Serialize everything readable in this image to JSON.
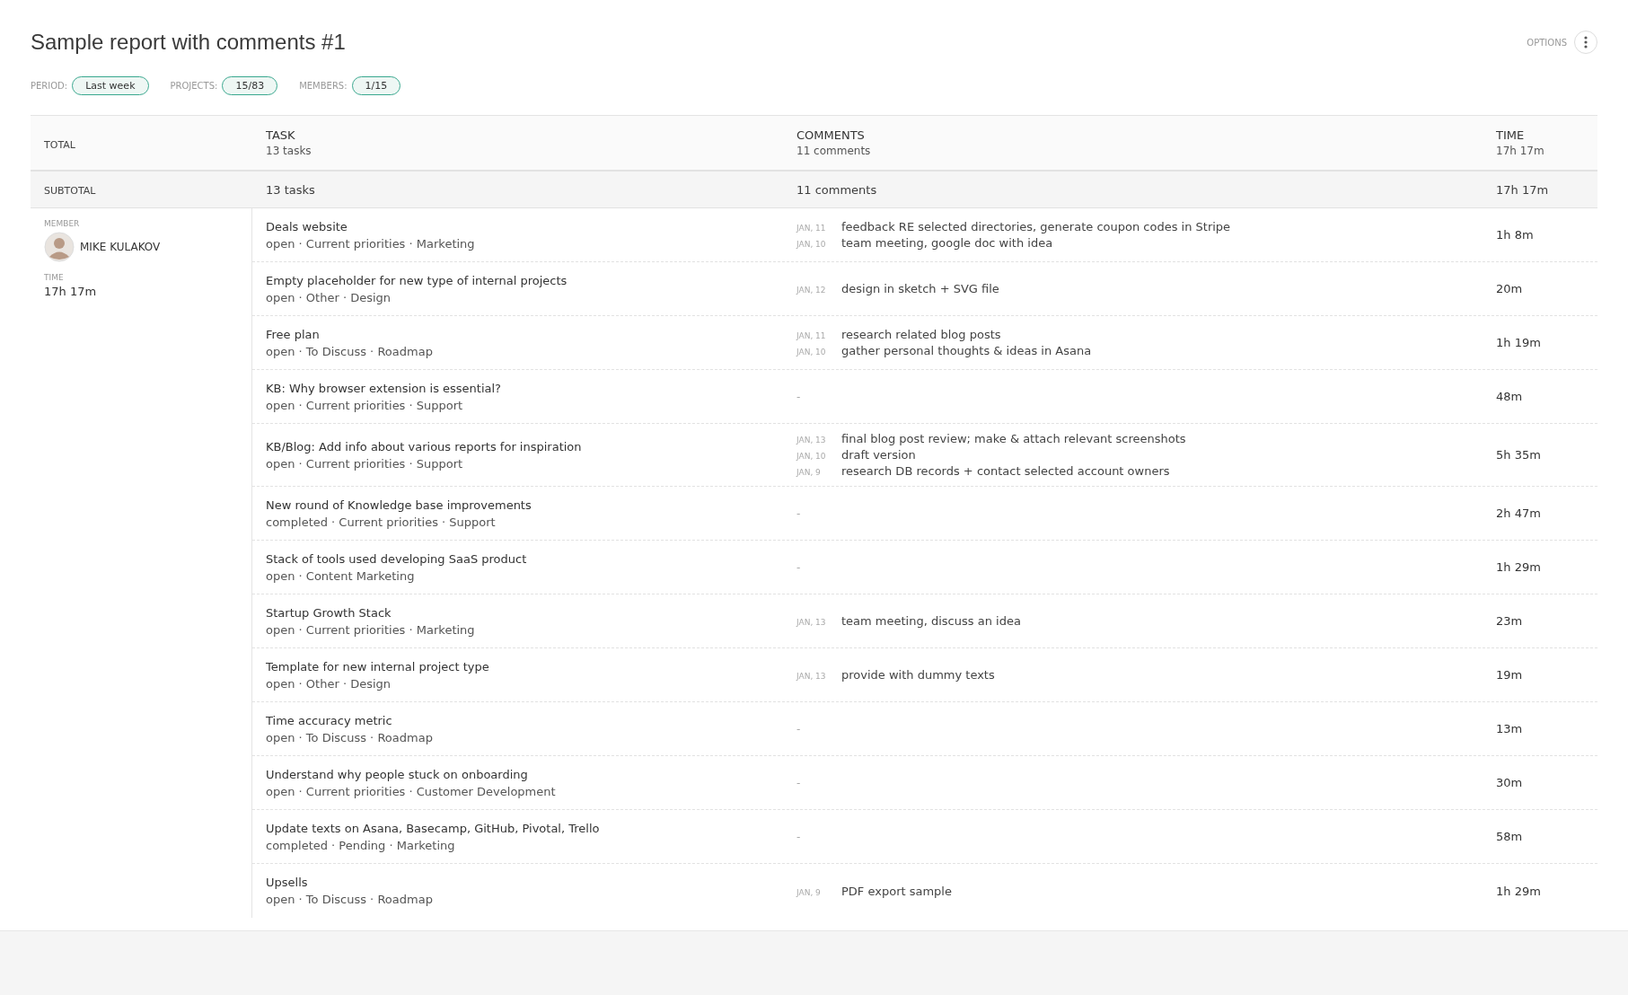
{
  "title": "Sample report with comments #1",
  "options": {
    "label": "OPTIONS"
  },
  "filters": [
    {
      "label": "PERIOD:",
      "value": "Last week"
    },
    {
      "label": "PROJECTS:",
      "value": "15/83"
    },
    {
      "label": "MEMBERS:",
      "value": "1/15"
    }
  ],
  "table": {
    "columns": [
      {
        "label": "TOTAL"
      },
      {
        "label": "TASK",
        "total": "13 tasks"
      },
      {
        "label": "COMMENTS",
        "total": "11 comments"
      },
      {
        "label": "TIME",
        "total": "17h 17m"
      }
    ],
    "subtotal": {
      "label": "SUBTOTAL",
      "tasks": "13 tasks",
      "comments": "11 comments",
      "time": "17h 17m"
    },
    "member": {
      "member_label": "MEMBER",
      "name": "MIKE KULAKOV",
      "time_label": "TIME",
      "time": "17h 17m"
    },
    "rows": [
      {
        "task": "Deals website",
        "meta": "open · Current priorities · Marketing",
        "comments": [
          {
            "date": "JAN, 11",
            "text": "feedback RE selected directories, generate coupon codes in Stripe"
          },
          {
            "date": "JAN, 10",
            "text": "team meeting, google doc with idea"
          }
        ],
        "time": "1h 8m"
      },
      {
        "task": "Empty placeholder for new type of internal projects",
        "meta": "open · Other · Design",
        "comments": [
          {
            "date": "JAN, 12",
            "text": "design in sketch + SVG file"
          }
        ],
        "time": "20m"
      },
      {
        "task": "Free plan",
        "meta": "open · To Discuss · Roadmap",
        "comments": [
          {
            "date": "JAN, 11",
            "text": "research related blog posts"
          },
          {
            "date": "JAN, 10",
            "text": "gather personal thoughts & ideas in Asana"
          }
        ],
        "time": "1h 19m"
      },
      {
        "task": "KB: Why browser extension is essential?",
        "meta": "open · Current priorities · Support",
        "no_comments": "-",
        "time": "48m"
      },
      {
        "task": "KB/Blog: Add info about various reports for inspiration",
        "meta": "open · Current priorities · Support",
        "comments": [
          {
            "date": "JAN, 13",
            "text": "final blog post review; make & attach relevant screenshots"
          },
          {
            "date": "JAN, 10",
            "text": "draft version"
          },
          {
            "date": "JAN, 9",
            "text": "research DB records + contact selected account owners"
          }
        ],
        "time": "5h 35m"
      },
      {
        "task": "New round of Knowledge base improvements",
        "meta": "completed · Current priorities · Support",
        "no_comments": "-",
        "time": "2h 47m"
      },
      {
        "task": "Stack of tools used developing SaaS product",
        "meta": "open · Content Marketing",
        "no_comments": "-",
        "time": "1h 29m"
      },
      {
        "task": "Startup Growth Stack",
        "meta": "open · Current priorities · Marketing",
        "comments": [
          {
            "date": "JAN, 13",
            "text": "team meeting, discuss an idea"
          }
        ],
        "time": "23m"
      },
      {
        "task": "Template for new internal project type",
        "meta": "open · Other · Design",
        "comments": [
          {
            "date": "JAN, 13",
            "text": "provide with dummy texts"
          }
        ],
        "time": "19m"
      },
      {
        "task": "Time accuracy metric",
        "meta": "open · To Discuss · Roadmap",
        "no_comments": "-",
        "time": "13m"
      },
      {
        "task": "Understand why people stuck on onboarding",
        "meta": "open · Current priorities · Customer Development",
        "no_comments": "-",
        "time": "30m"
      },
      {
        "task": "Update texts on Asana, Basecamp, GitHub, Pivotal, Trello",
        "meta": "completed · Pending · Marketing",
        "no_comments": "-",
        "time": "58m"
      },
      {
        "task": "Upsells",
        "meta": "open · To Discuss · Roadmap",
        "comments": [
          {
            "date": "JAN, 9",
            "text": "PDF export sample"
          }
        ],
        "time": "1h 29m"
      }
    ]
  }
}
